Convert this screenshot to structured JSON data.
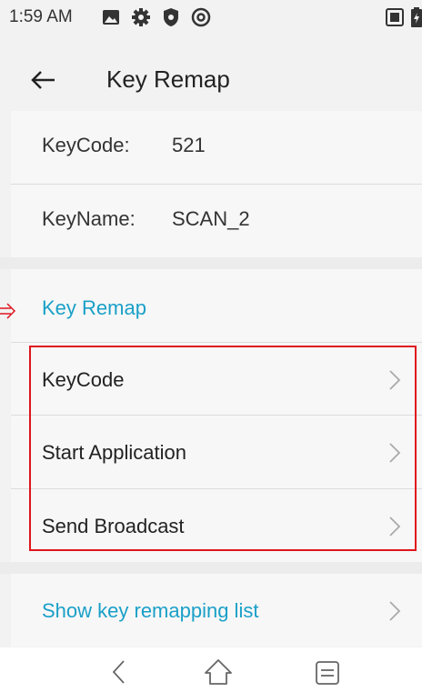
{
  "status_bar": {
    "time": "1:59 AM",
    "icons": [
      "image-icon",
      "gear-icon",
      "shield-icon",
      "at-sign-icon"
    ],
    "right_icons": [
      "sim-icon",
      "battery-icon"
    ]
  },
  "app_bar": {
    "title": "Key Remap",
    "back_icon": "back-arrow-icon"
  },
  "key_info": {
    "keycode_label": "KeyCode:",
    "keycode_value": "521",
    "keyname_label": "KeyName:",
    "keyname_value": "SCAN_2"
  },
  "remap_section": {
    "title": "Key Remap",
    "items": [
      {
        "label": "KeyCode"
      },
      {
        "label": "Start Application"
      },
      {
        "label": "Send Broadcast"
      }
    ]
  },
  "footer_link": {
    "label": "Show key remapping list"
  },
  "colors": {
    "accent": "#1aa0c8",
    "highlight": "#e0141c",
    "background": "#f2f2f2"
  }
}
